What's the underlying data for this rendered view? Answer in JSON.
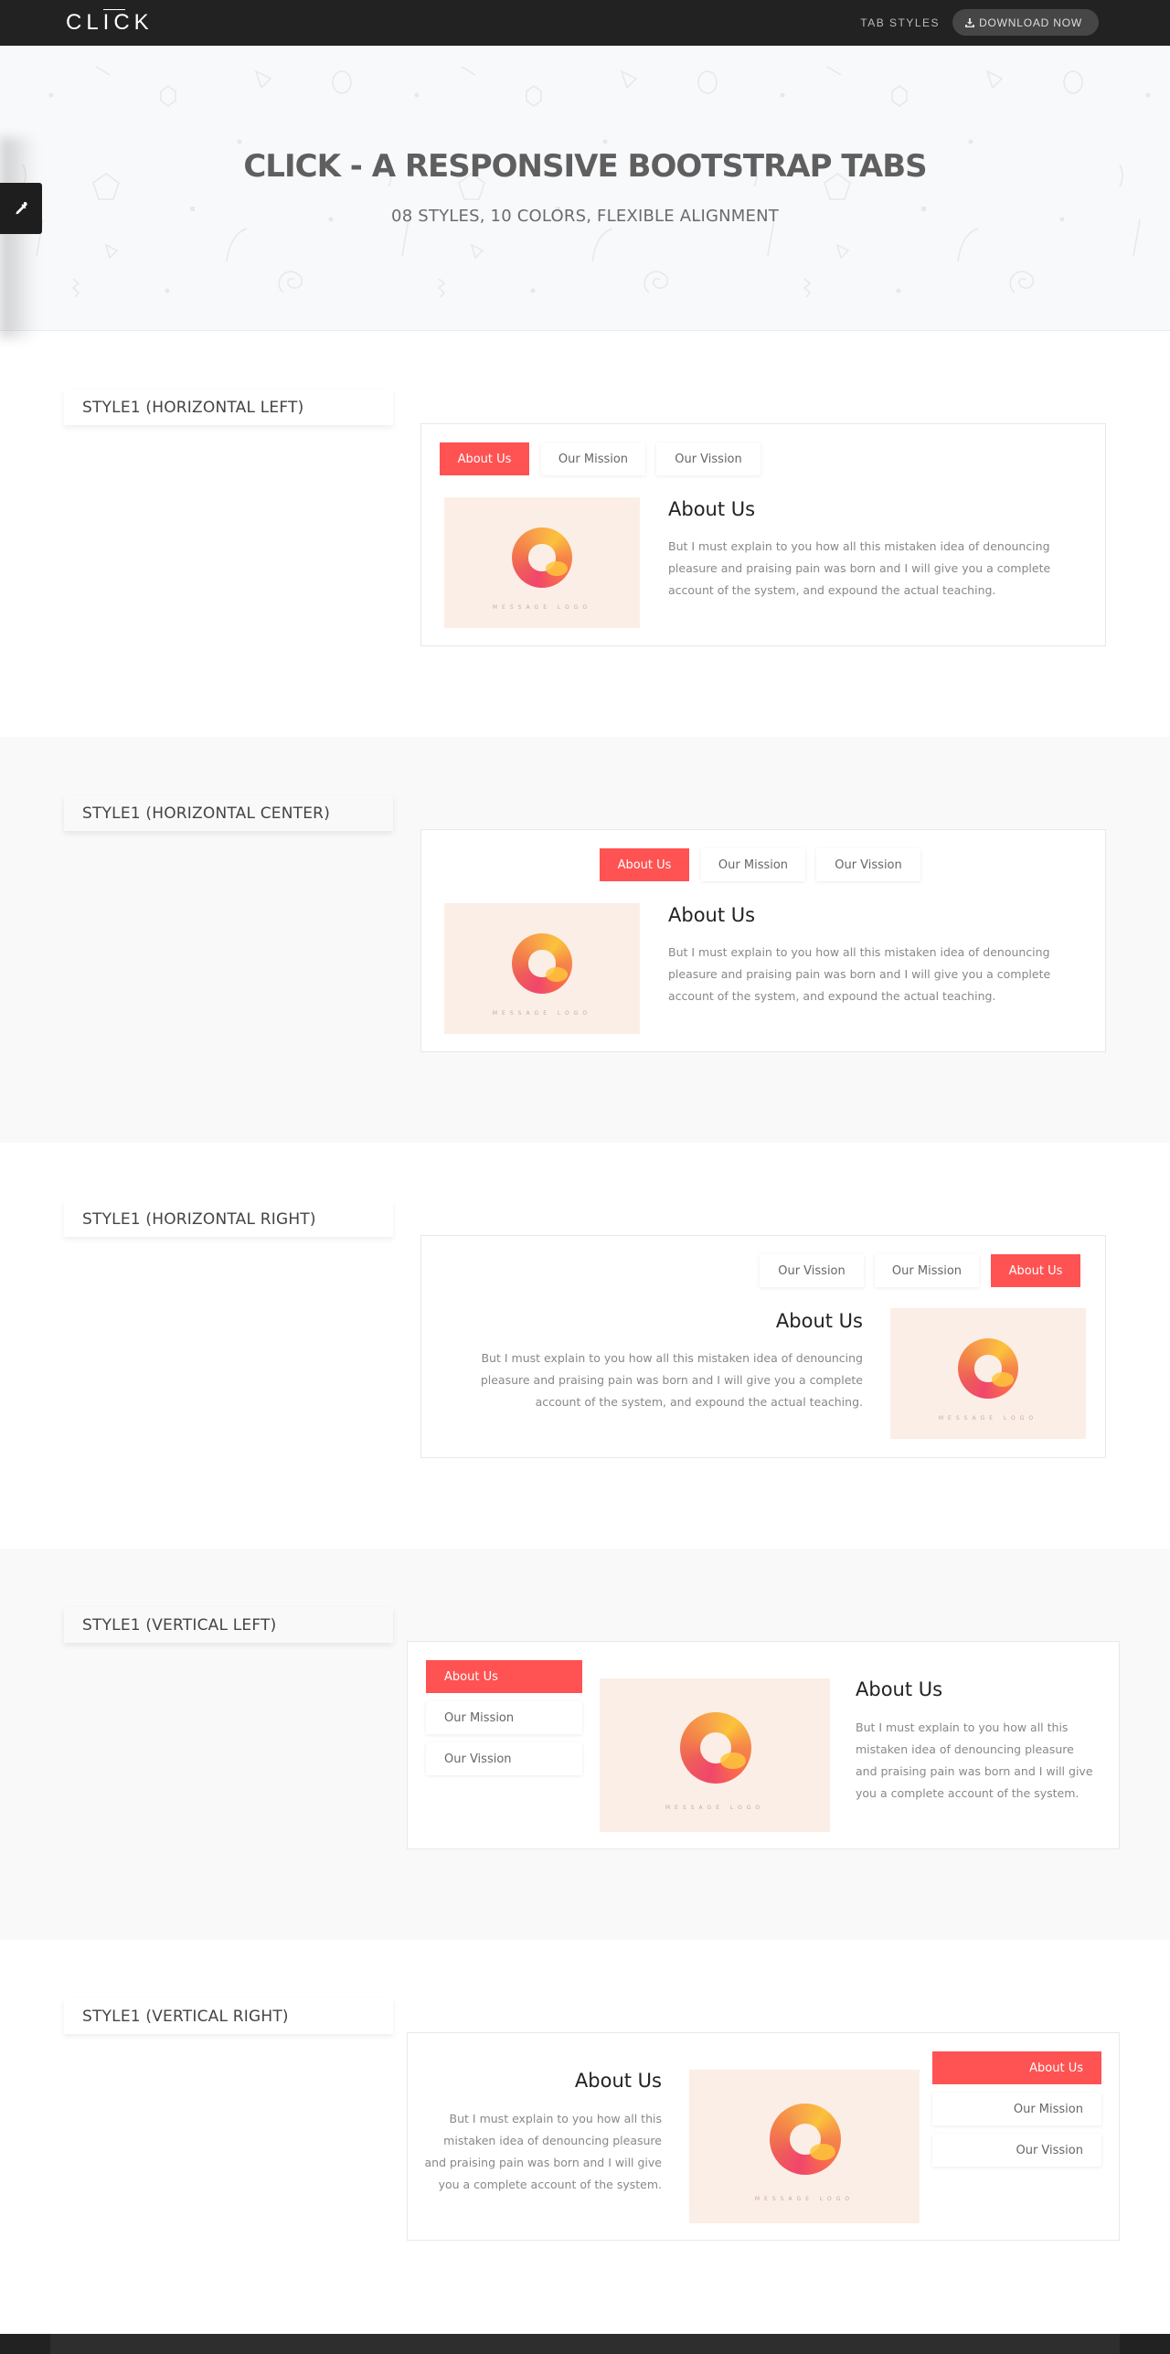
{
  "header": {
    "logo_text": "CLICK",
    "nav_link": "TAB STYLES",
    "download_label": "DOWNLOAD NOW",
    "download_icon": "download-icon"
  },
  "hero": {
    "title": "CLICK - A RESPONSIVE BOOTSTRAP TABS",
    "subtitle": "08 STYLES, 10 COLORS, FLEXIBLE ALIGNMENT"
  },
  "switcher": {
    "icon": "eyedropper-icon"
  },
  "colors": {
    "accent": "#ff5252",
    "header_bg": "#222222",
    "hero_bg": "#f8f9fb",
    "alt_section_bg": "#f9f9f9",
    "thumb_bg": "#fbeee6"
  },
  "content": {
    "title": "About Us",
    "text_long": "But I must explain to you how all this mistaken idea of denouncing pleasure and praising pain was born and I will give you a complete account of the system, and expound the actual teaching.",
    "text_short": "But I must explain to you how all this mistaken idea of denouncing pleasure and praising pain was born and I will give you a complete account of the system.",
    "thumb_caption": "MESSAGE LOGO"
  },
  "tabs": {
    "about": "About Us",
    "mission": "Our Mission",
    "vision": "Our Vission"
  },
  "sections": [
    {
      "label": "STYLE1 (HORIZONTAL LEFT)",
      "active_tab": "About Us"
    },
    {
      "label": "STYLE1 (HORIZONTAL CENTER)",
      "active_tab": "About Us"
    },
    {
      "label": "STYLE1 (HORIZONTAL RIGHT)",
      "active_tab": "About Us"
    },
    {
      "label": "STYLE1 (VERTICAL LEFT)",
      "active_tab": "About Us"
    },
    {
      "label": "STYLE1 (VERTICAL RIGHT)",
      "active_tab": "About Us"
    }
  ]
}
